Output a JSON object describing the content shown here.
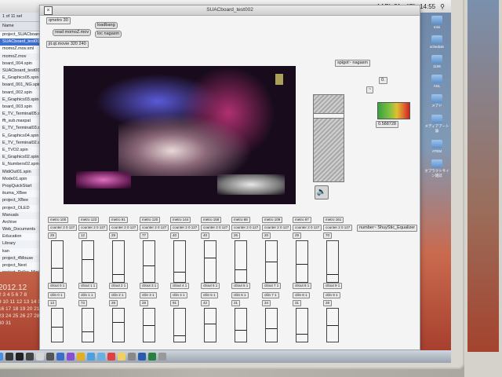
{
  "menubar": {
    "items": [
      "AAPL 31",
      "47°",
      "14:55"
    ],
    "search_icon": "search-icon"
  },
  "finder": {
    "header": "1 of 11 sel",
    "name_col": "Name",
    "items": [
      "project_SUACboard",
      "SUACboard_test002",
      "momoZ.mov.xml",
      "momoZ.mov",
      "board_004.spin",
      "SUACboard_test001",
      "E_Graphics05.spin",
      "board_001_NG.spin",
      "board_002.spin",
      "E_Graphics03.spin",
      "board_003.spin",
      "E_TV_Terminal05.spin",
      "fft_sub.maxpat",
      "E_TV_Terminal03.spin",
      "E_Graphics04.spin",
      "E_TV_Terminal02.spin",
      "E_TVO2.spin",
      "E_Graphics02.spin",
      "E_Numbers02.spin",
      "MidiOut01.spin",
      "Mode01.spin",
      "PropQuickStart",
      "ikuma_XBee",
      "project_XBee",
      "project_OLED",
      "Manuals",
      "Archive",
      "Web_Documents",
      "Education",
      "Library",
      "kan",
      "project_4Mouse",
      "project_Next",
      "project_Peller_Mini"
    ]
  },
  "calendar": {
    "year": "2012.12",
    "weeks": [
      [
        "2",
        "3",
        "4",
        "5",
        "6",
        "7",
        "8"
      ],
      [
        "9",
        "10",
        "11",
        "12",
        "13",
        "14",
        "15"
      ],
      [
        "16",
        "17",
        "18",
        "19",
        "20",
        "21",
        "22"
      ],
      [
        "23",
        "24",
        "25",
        "26",
        "27",
        "28",
        "29"
      ],
      [
        "30",
        "31"
      ]
    ]
  },
  "desktop_icons": [
    "mini",
    "schedule",
    "1106",
    "ASL",
    "メアド",
    "メディアアート論",
    "ATEM",
    "オプラクトサイン雑誌"
  ],
  "window": {
    "title": "SUACboard_test002",
    "objects": {
      "qmetro": "qmetro 30",
      "loadbang": "loadbang",
      "read": "read momoZ.mov",
      "loc": "loc nagasm",
      "jit": "jit.qt.movie 320 240",
      "spigot": "spigot~ nagasm",
      "small_num": "0.",
      "small_box": "~",
      "readout": "0.588728",
      "equalizer": "number~ ShuyStic_Equalizer"
    },
    "channels": [
      {
        "metro": "metro 100",
        "counter": "counter 2 0 127",
        "num": "29",
        "ctl": "ctlout 0 1",
        "ctl2": "ctlin 0 1",
        "num2": "13",
        "level": 0.35,
        "level2": 0.45
      },
      {
        "metro": "metro 123",
        "counter": "counter 2 0 127",
        "num": "12",
        "ctl": "ctlout 1 1",
        "ctl2": "ctlin 1 1",
        "num2": "73",
        "level": 0.55,
        "level2": 0.3
      },
      {
        "metro": "metro 91",
        "counter": "counter 2 0 127",
        "num": "29",
        "ctl": "ctlout 2 1",
        "ctl2": "ctlin 2 1",
        "num2": "28",
        "level": 0.2,
        "level2": 0.6
      },
      {
        "metro": "metro 120",
        "counter": "counter 2 0 127",
        "num": "77",
        "ctl": "ctlout 3 1",
        "ctl2": "ctlin 3 1",
        "num2": "28",
        "level": 0.4,
        "level2": 0.5
      },
      {
        "metro": "metro 144",
        "counter": "counter 2 0 127",
        "num": "40",
        "ctl": "ctlout 4 1",
        "ctl2": "ctlin 4 1",
        "num2": "91",
        "level": 0.25,
        "level2": 0.2
      },
      {
        "metro": "metro 158",
        "counter": "counter 2 0 127",
        "num": "40",
        "ctl": "ctlout 5 1",
        "ctl2": "ctlin 5 1",
        "num2": "42",
        "level": 0.6,
        "level2": 0.55
      },
      {
        "metro": "metro 88",
        "counter": "counter 2 0 127",
        "num": "26",
        "ctl": "ctlout 6 1",
        "ctl2": "ctlin 6 1",
        "num2": "31",
        "level": 0.3,
        "level2": 0.35
      },
      {
        "metro": "metro 109",
        "counter": "counter 2 0 127",
        "num": "20",
        "ctl": "ctlout 7 1",
        "ctl2": "ctlin 7 1",
        "num2": "34",
        "level": 0.5,
        "level2": 0.4
      },
      {
        "metro": "metro 97",
        "counter": "counter 2 0 127",
        "num": "29",
        "ctl": "ctlout 8 1",
        "ctl2": "ctlin 8 1",
        "num2": "31",
        "level": 0.45,
        "level2": 0.25
      },
      {
        "metro": "metro 161",
        "counter": "counter 2 0 127",
        "num": "70",
        "ctl": "ctlout 9 1",
        "ctl2": "ctlin 9 1",
        "num2": "28",
        "level": 0.2,
        "level2": 0.5
      }
    ],
    "gain_level": 0.78
  },
  "dock": {
    "icons": [
      "finder-icon",
      "dashboard-icon",
      "terminal-icon",
      "app5-icon",
      "preview-icon",
      "max-icon",
      "photo-icon",
      "itunes-icon",
      "chrome-icon",
      "safari-icon",
      "mail-icon",
      "calendar-icon",
      "notes-icon",
      "settings-icon",
      "word-icon",
      "excel-icon",
      "trash-icon"
    ]
  }
}
